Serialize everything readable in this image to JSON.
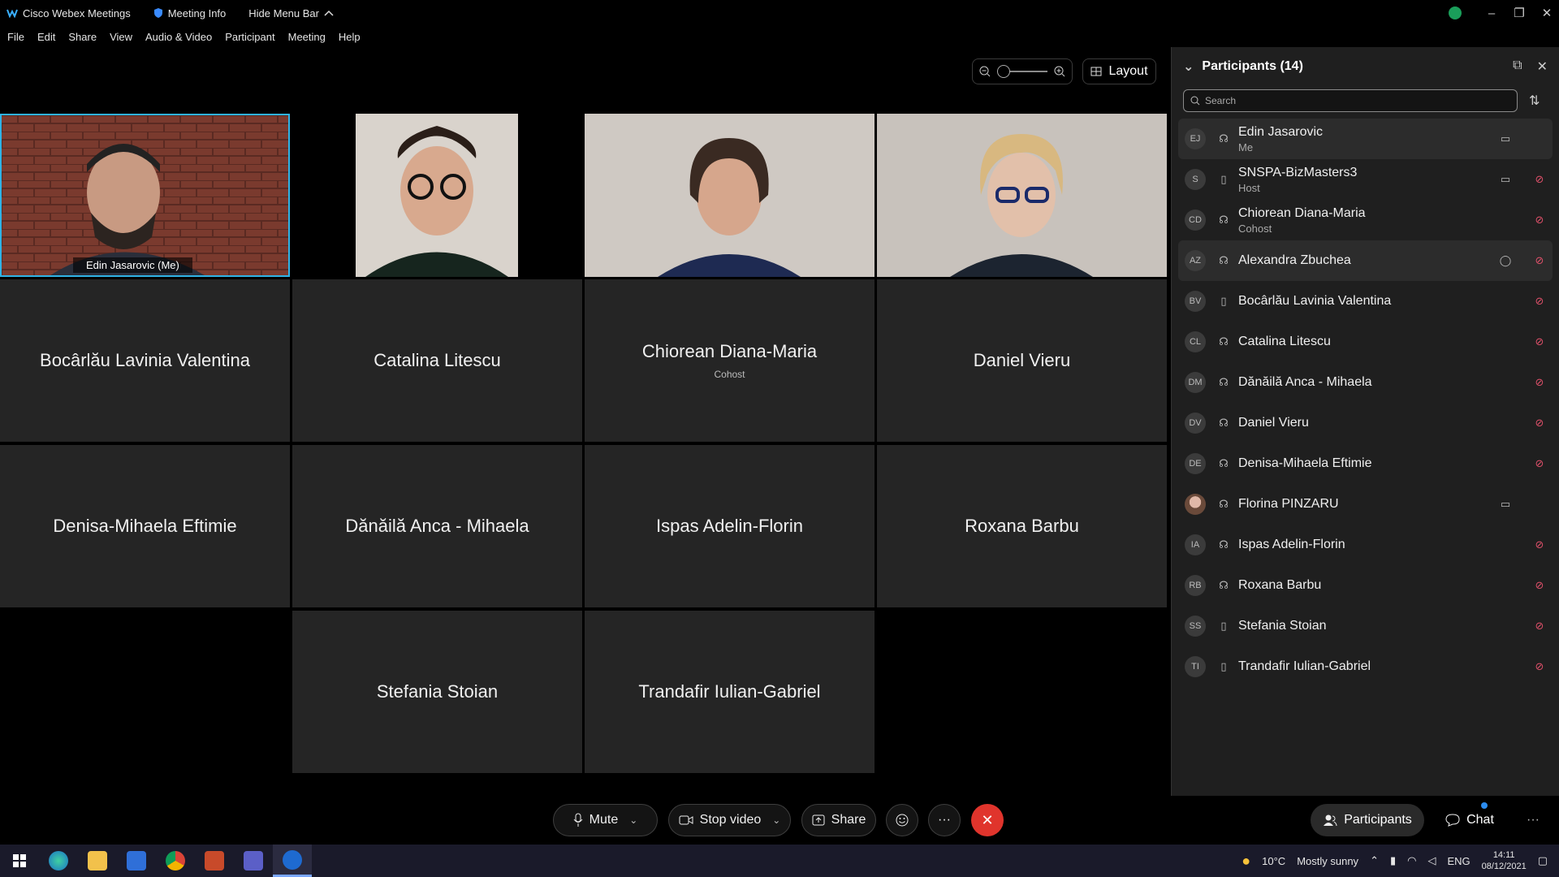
{
  "titlebar": {
    "app_name": "Cisco Webex Meetings",
    "meeting_info": "Meeting Info",
    "hide_menu_bar": "Hide Menu Bar",
    "window_controls": {
      "minimize": "–",
      "maximize": "❐",
      "close": "✕"
    }
  },
  "menu": [
    "File",
    "Edit",
    "Share",
    "View",
    "Audio & Video",
    "Participant",
    "Meeting",
    "Help"
  ],
  "zoom": {
    "level": 0
  },
  "layout_button": "Layout",
  "grid": {
    "self_label": "Edin Jasarovic  (Me)",
    "tiles": [
      {
        "name": "Bocârlău Lavinia Valentina",
        "role": ""
      },
      {
        "name": "Catalina Litescu",
        "role": ""
      },
      {
        "name": "Chiorean Diana-Maria",
        "role": "Cohost"
      },
      {
        "name": "Daniel Vieru",
        "role": ""
      },
      {
        "name": "Denisa-Mihaela Eftimie",
        "role": ""
      },
      {
        "name": "Dănăilă Anca - Mihaela",
        "role": ""
      },
      {
        "name": "Ispas Adelin-Florin",
        "role": ""
      },
      {
        "name": "Roxana Barbu",
        "role": ""
      },
      {
        "name": "Stefania Stoian",
        "role": ""
      },
      {
        "name": "Trandafir Iulian-Gabriel",
        "role": ""
      }
    ]
  },
  "panel": {
    "title": "Participants (14)",
    "search_placeholder": "Search",
    "participants": [
      {
        "initials": "EJ",
        "name": "Edin Jasarovic",
        "role": "Me"
      },
      {
        "initials": "S",
        "name": "SNSPA-BizMasters3",
        "role": "Host"
      },
      {
        "initials": "CD",
        "name": "Chiorean Diana-Maria",
        "role": "Cohost"
      },
      {
        "initials": "AZ",
        "name": "Alexandra Zbuchea",
        "role": ""
      },
      {
        "initials": "BV",
        "name": "Bocârlău Lavinia Valentina",
        "role": ""
      },
      {
        "initials": "CL",
        "name": "Catalina Litescu",
        "role": ""
      },
      {
        "initials": "DM",
        "name": "Dănăilă Anca - Mihaela",
        "role": ""
      },
      {
        "initials": "DV",
        "name": "Daniel Vieru",
        "role": ""
      },
      {
        "initials": "DE",
        "name": "Denisa-Mihaela Eftimie",
        "role": ""
      },
      {
        "initials": "",
        "name": "Florina PINZARU",
        "role": ""
      },
      {
        "initials": "IA",
        "name": "Ispas Adelin-Florin",
        "role": ""
      },
      {
        "initials": "RB",
        "name": "Roxana Barbu",
        "role": ""
      },
      {
        "initials": "SS",
        "name": "Stefania Stoian",
        "role": ""
      },
      {
        "initials": "TI",
        "name": "Trandafir Iulian-Gabriel",
        "role": ""
      }
    ]
  },
  "controls": {
    "mute": "Mute",
    "stop_video": "Stop video",
    "share": "Share",
    "participants": "Participants",
    "chat": "Chat",
    "more": "···"
  },
  "taskbar": {
    "temperature": "10°C",
    "weather": "Mostly sunny",
    "language": "ENG",
    "time": "14:11",
    "date": "08/12/2021"
  },
  "colors": {
    "accent_blue": "#2fb3e6",
    "end_red": "#e0342c",
    "muted_red": "#e0506a",
    "status_green": "#1a9e5a"
  }
}
